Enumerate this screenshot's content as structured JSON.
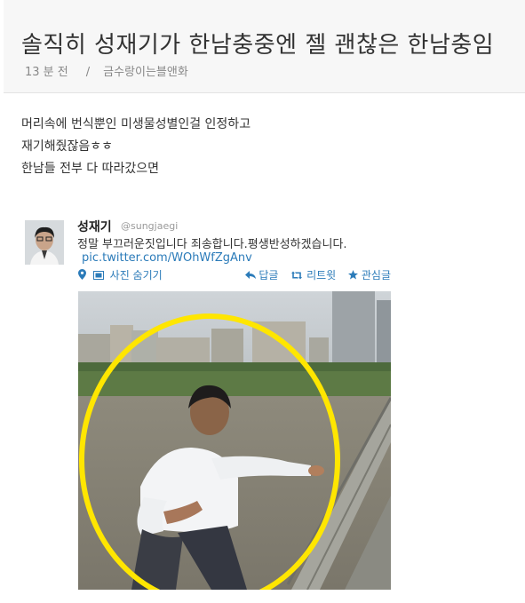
{
  "post": {
    "title": "솔직히 성재기가 한남충중엔 젤 괜찮은 한남충임",
    "time": "13 분 전",
    "separator": "/",
    "author": "금수랑이는블앤화",
    "lines": [
      "머리속에 번식뿐인 미생물성별인걸 인정하고",
      "재기해줬잖음ㅎㅎ",
      "한남들 전부 다 따라갔으면"
    ]
  },
  "tweet": {
    "name": "성재기",
    "handle": "@sungjaegi",
    "text": "정말 부끄러운짓입니다 죄송합니다.평생반성하겠습니다.",
    "link": "pic.twitter.com/WOhWfZgAnv",
    "hide_photo": "사진 숨기기",
    "reply": "답글",
    "retweet": "리트윗",
    "favorite": "관심글"
  },
  "colors": {
    "link": "#2b7bb9",
    "header_bg": "#f7f7f7",
    "highlight_circle": "#ffe600"
  },
  "icons": [
    "location-pin-icon",
    "photo-icon",
    "reply-icon",
    "retweet-icon",
    "star-icon"
  ]
}
